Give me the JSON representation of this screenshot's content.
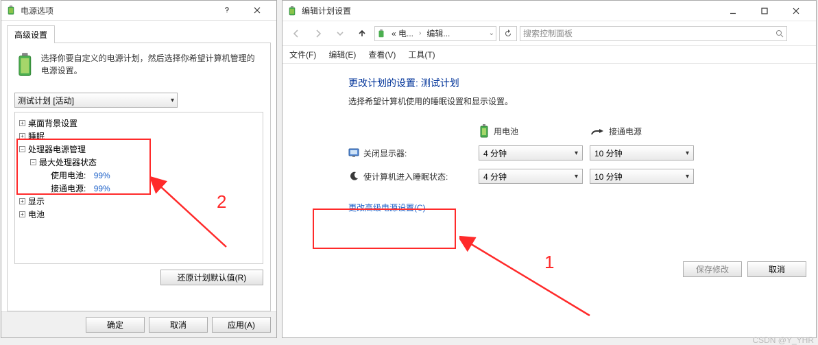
{
  "left": {
    "title": "电源选项",
    "tab": "高级设置",
    "desc": "选择你要自定义的电源计划，然后选择你希望计算机管理的电源设置。",
    "plan": "测试计划 [活动]",
    "tree": {
      "n1": "桌面背景设置",
      "n2": "睡眠",
      "n3": "处理器电源管理",
      "n3_1": "最大处理器状态",
      "n3_1_a_lbl": "使用电池:",
      "n3_1_a_val": "99%",
      "n3_1_b_lbl": "接通电源:",
      "n3_1_b_val": "99%",
      "n4": "显示",
      "n5": "电池"
    },
    "restore": "还原计划默认值(R)",
    "ok": "确定",
    "cancel": "取消",
    "apply": "应用(A)",
    "anno": "2"
  },
  "right": {
    "title": "编辑计划设置",
    "crumbs": {
      "a": "« 电...",
      "b": "编辑..."
    },
    "search_ph": "搜索控制面板",
    "menu": {
      "file": "文件(F)",
      "edit": "编辑(E)",
      "view": "查看(V)",
      "tools": "工具(T)"
    },
    "heading": "更改计划的设置: 测试计划",
    "subhead": "选择希望计算机使用的睡眠设置和显示设置。",
    "col_battery": "用电池",
    "col_plugged": "接通电源",
    "row1_lbl": "关闭显示器:",
    "row1_a": "4 分钟",
    "row1_b": "10 分钟",
    "row2_lbl": "使计算机进入睡眠状态:",
    "row2_a": "4 分钟",
    "row2_b": "10 分钟",
    "link": "更改高级电源设置(C)",
    "save": "保存修改",
    "cancel": "取消",
    "anno": "1"
  },
  "watermark": "CSDN @Y_YHR"
}
